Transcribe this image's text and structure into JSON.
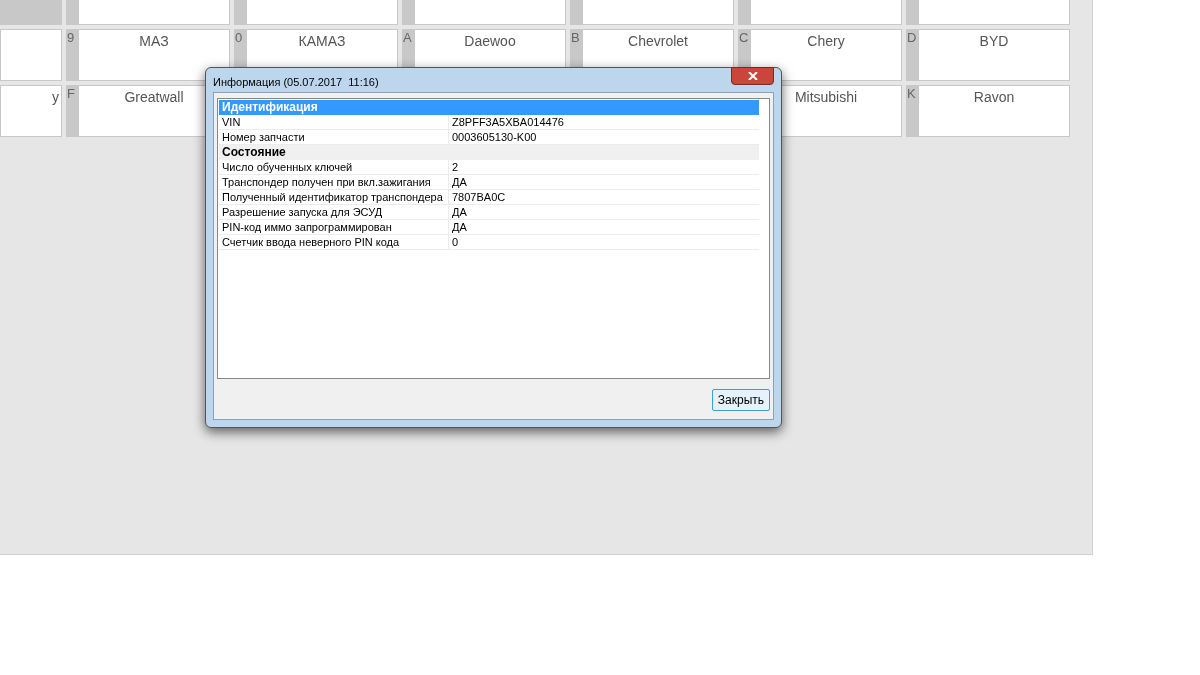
{
  "tile_rows": [
    {
      "tiles": [
        {
          "kind": "tile",
          "selected": true
        },
        {
          "kind": "tile",
          "selected": false
        },
        {
          "kind": "tile",
          "selected": false
        },
        {
          "kind": "tile",
          "selected": false
        },
        {
          "kind": "tile",
          "selected": false
        },
        {
          "kind": "tile",
          "selected": false
        },
        {
          "kind": "tile",
          "selected": false
        }
      ]
    },
    {
      "tiles": [
        {
          "kind": "tile",
          "selected": false
        },
        {
          "kind": "tile",
          "key": "9",
          "label": "МАЗ",
          "selected": false
        },
        {
          "kind": "tile",
          "key": "0",
          "label": "КАМАЗ",
          "selected": false
        },
        {
          "kind": "tile",
          "key": "A",
          "label": "Daewoo",
          "selected": false
        },
        {
          "kind": "tile",
          "key": "B",
          "label": "Chevrolet",
          "selected": false
        },
        {
          "kind": "tile",
          "key": "C",
          "label": "Chery",
          "selected": false
        },
        {
          "kind": "tile",
          "key": "D",
          "label": "BYD",
          "selected": false
        }
      ]
    },
    {
      "tiles": [
        {
          "kind": "tile",
          "label": "y",
          "selected": false
        },
        {
          "kind": "tile",
          "key": "F",
          "label": "Greatwall",
          "selected": false
        },
        {
          "kind": "covered"
        },
        {
          "kind": "covered"
        },
        {
          "kind": "covered"
        },
        {
          "kind": "tile",
          "label": "Mitsubishi",
          "selected": false
        },
        {
          "kind": "tile",
          "key": "K",
          "label": "Ravon",
          "selected": false
        }
      ]
    }
  ],
  "dialog": {
    "title": "Информация (05.07.2017  11:16)",
    "rows": [
      {
        "kind": "section",
        "name": "Идентификация",
        "selected": true
      },
      {
        "kind": "item",
        "name": "VIN",
        "value": "Z8PFF3A5XBA014476"
      },
      {
        "kind": "item",
        "name": "Номер запчасти",
        "value": "0003605130-K00"
      },
      {
        "kind": "section",
        "name": "Состояние",
        "selected": false
      },
      {
        "kind": "item",
        "name": "Число обученных ключей",
        "value": "2"
      },
      {
        "kind": "item",
        "name": "Транспондер получен при вкл.зажигания",
        "value": "ДА"
      },
      {
        "kind": "item",
        "name": "Полученный идентификатор транспондера",
        "value": "7807BA0C"
      },
      {
        "kind": "item",
        "name": "Разрешение запуска для ЭСУД",
        "value": "ДА"
      },
      {
        "kind": "item",
        "name": "PIN-код иммо запрограммирован",
        "value": "ДА"
      },
      {
        "kind": "item",
        "name": "Счетчик ввода неверного PIN кода",
        "value": "0"
      }
    ],
    "close_button": "Закрыть"
  }
}
